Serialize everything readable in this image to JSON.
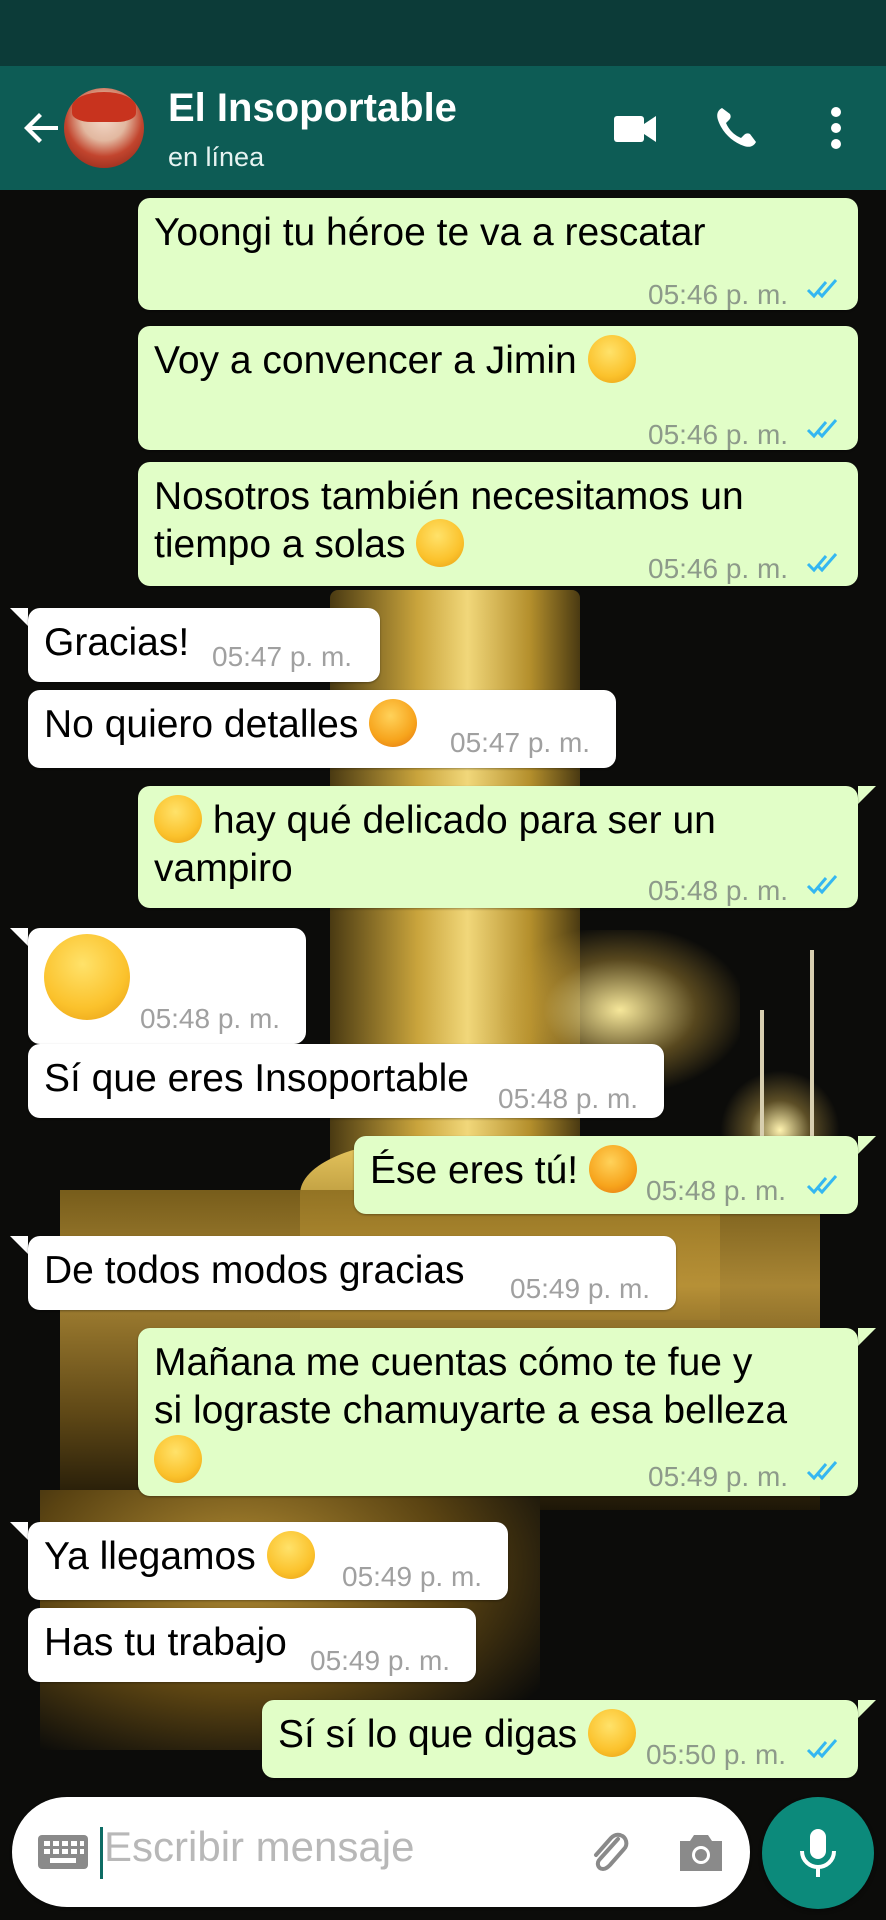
{
  "header": {
    "contact_name": "El Insoportable",
    "contact_status": "en línea",
    "icons": [
      "back-arrow-icon",
      "video-call-icon",
      "phone-icon",
      "more-vert-icon"
    ]
  },
  "messages": [
    {
      "dir": "out",
      "text": "Yoongi tu héroe te va a rescatar",
      "time": "05:46 p. m.",
      "read": true
    },
    {
      "dir": "out",
      "text": "Voy a convencer a Jimin",
      "emoji": "smirking-face",
      "time": "05:46 p. m.",
      "read": true
    },
    {
      "dir": "out",
      "text": "Nosotros también necesitamos un",
      "text2": "tiempo a solas",
      "emoji": "drooling-face",
      "time": "05:46 p. m.",
      "read": true
    },
    {
      "dir": "in",
      "text": "Gracias!",
      "time": "05:47 p. m."
    },
    {
      "dir": "in",
      "text": "No quiero detalles",
      "emoji": "confounded-face",
      "time": "05:47 p. m."
    },
    {
      "dir": "out",
      "emoji": "face-with-hand-over-mouth",
      "text": "hay qué delicado para ser un",
      "text2": "vampiro",
      "time": "05:48 p. m.",
      "read": true
    },
    {
      "dir": "in",
      "emoji": "sleepy-face",
      "time": "05:48 p. m."
    },
    {
      "dir": "in",
      "text": "Sí que eres Insoportable",
      "time": "05:48 p. m."
    },
    {
      "dir": "out",
      "text": "Ése eres tú!",
      "emoji": "angry-face",
      "time": "05:48 p. m.",
      "read": true
    },
    {
      "dir": "in",
      "text": "De todos modos gracias",
      "time": "05:49 p. m."
    },
    {
      "dir": "out",
      "text": "Mañana me cuentas cómo te fue y",
      "text2": "si lograste chamuyarte a esa belleza",
      "emoji": "smirking-face",
      "time": "05:49 p. m.",
      "read": true
    },
    {
      "dir": "in",
      "text": "Ya llegamos",
      "emoji": "unamused-face",
      "time": "05:49 p. m."
    },
    {
      "dir": "in",
      "text": "Has tu trabajo",
      "time": "05:49 p. m."
    },
    {
      "dir": "out",
      "text": "Sí sí lo que digas",
      "emoji": "grinning-face",
      "time": "05:50 p. m.",
      "read": true
    }
  ],
  "input": {
    "placeholder": "Escribir mensaje",
    "icons": [
      "keyboard-icon",
      "attach-icon",
      "camera-icon",
      "mic-icon"
    ]
  },
  "colors": {
    "header": "#0d5c55",
    "status_bar": "#0c3b38",
    "outgoing_bubble": "#e1fec7",
    "incoming_bubble": "#ffffff",
    "read_ticks": "#34b7f1",
    "mic_button": "#0c8a7b"
  }
}
